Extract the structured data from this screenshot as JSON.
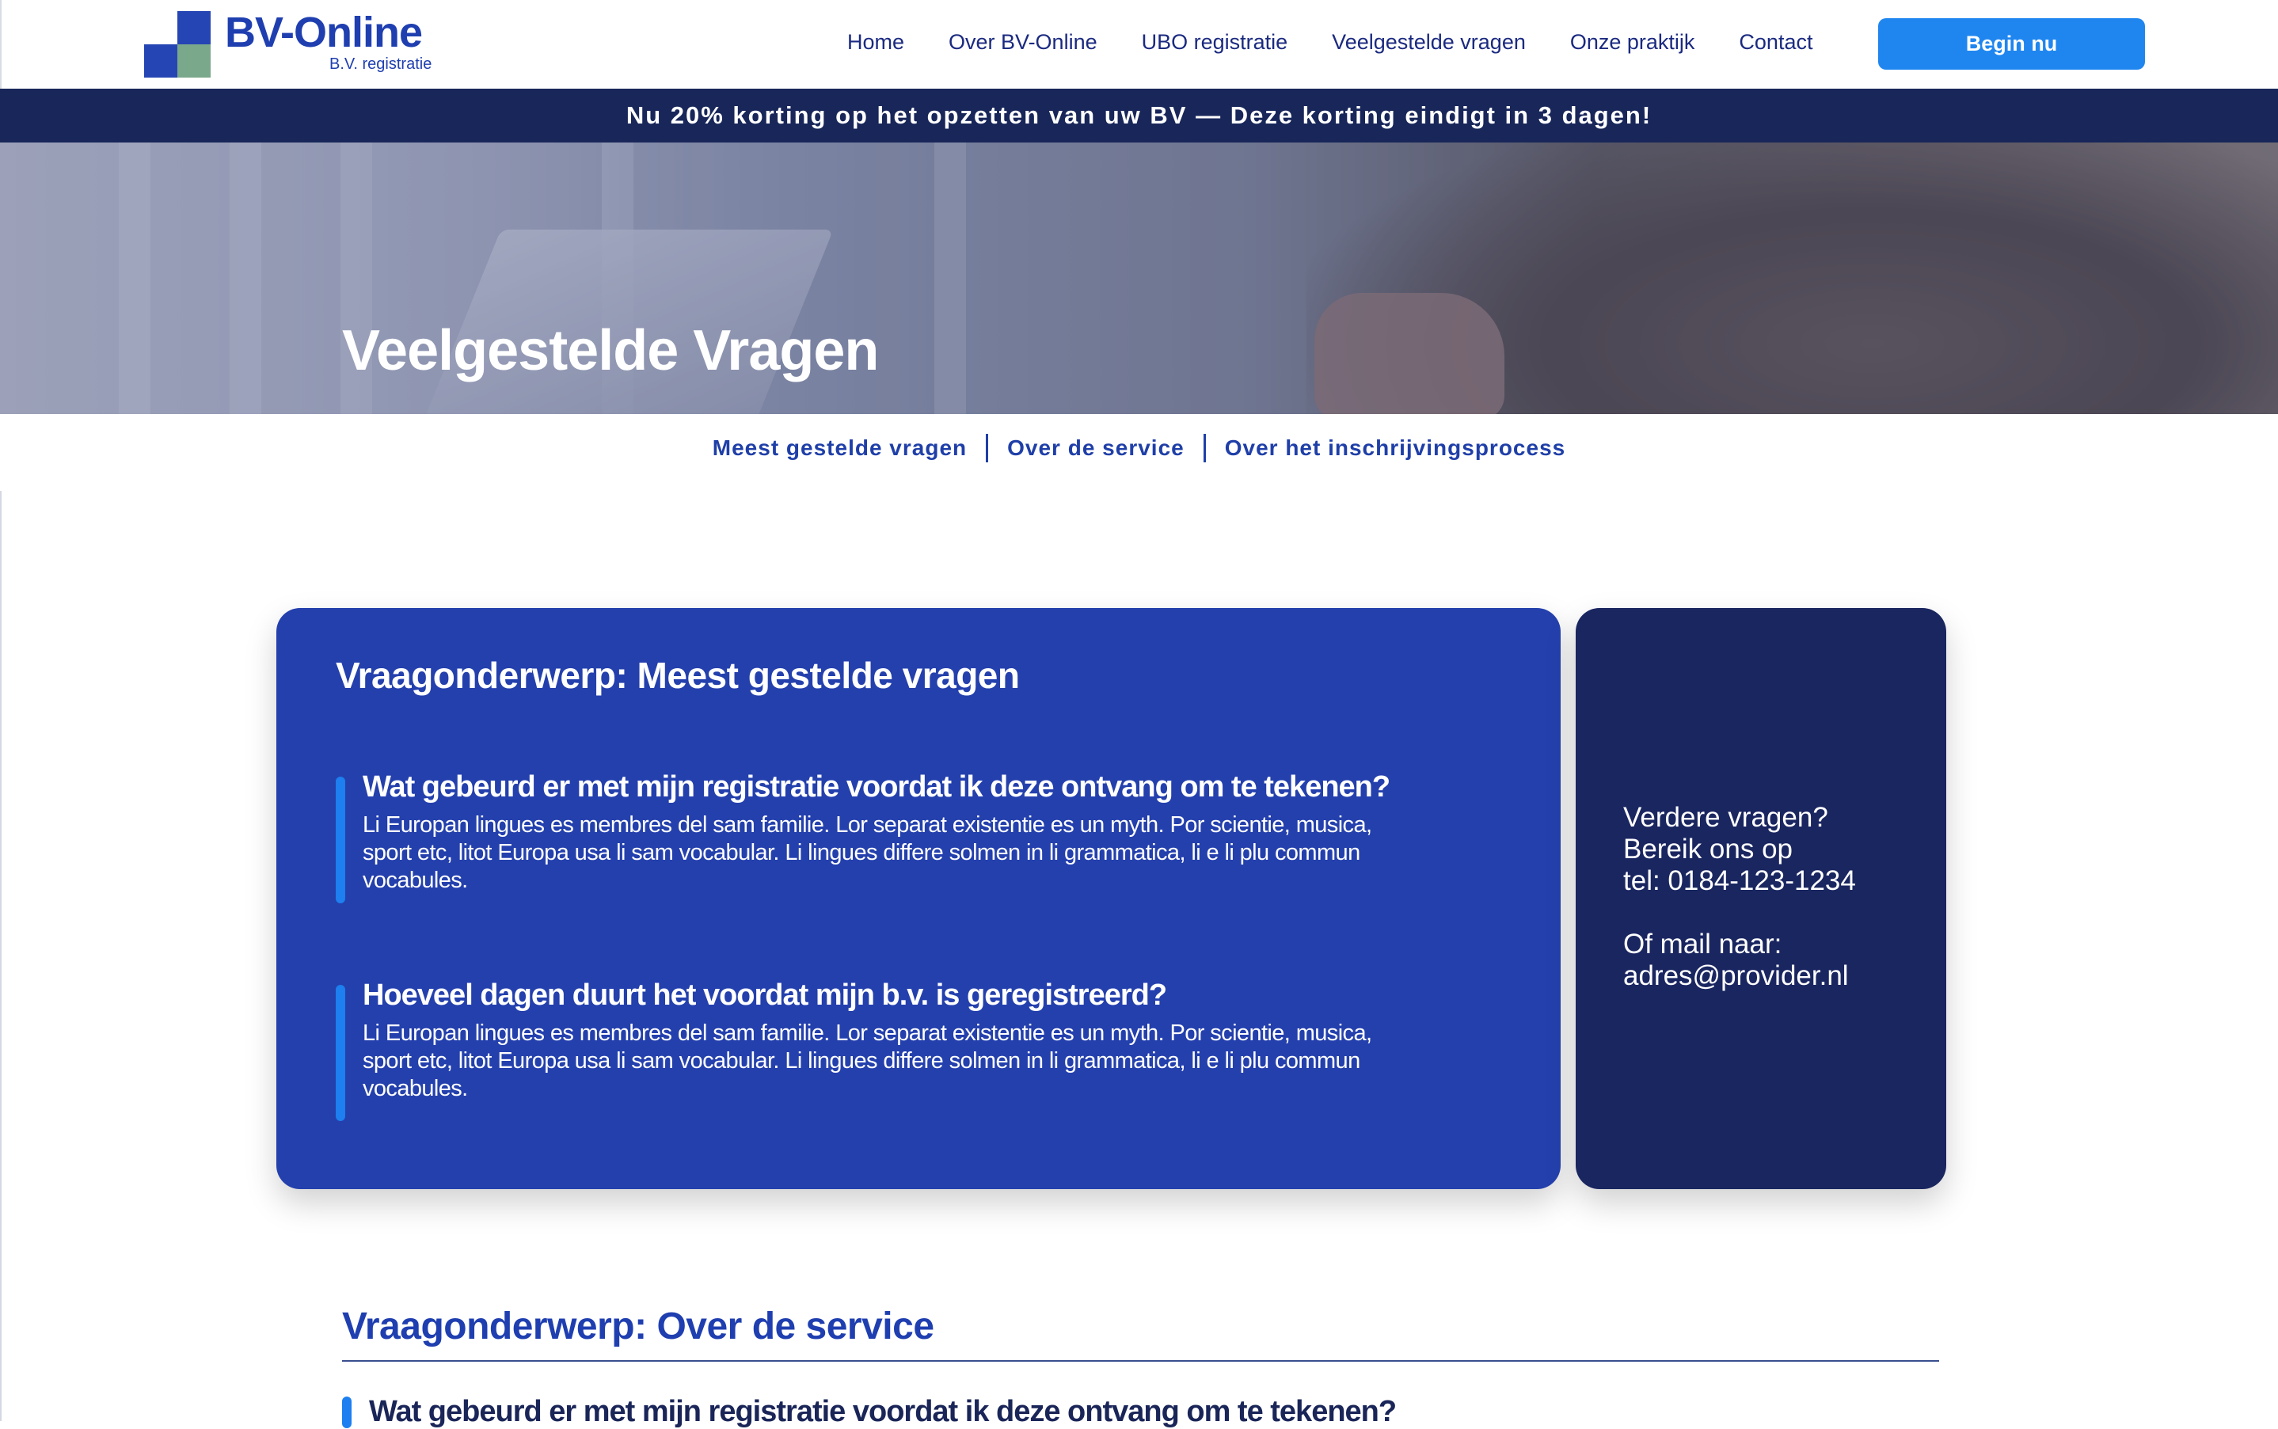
{
  "brand": {
    "title": "BV-Online",
    "subtitle": "B.V. registratie",
    "colors": {
      "primary": "#2440ad",
      "accent": "#1f86f0",
      "dark": "#1a2660",
      "logo_green": "#7aa88a"
    }
  },
  "nav": {
    "items": [
      {
        "label": "Home"
      },
      {
        "label": "Over BV-Online"
      },
      {
        "label": "UBO registratie"
      },
      {
        "label": "Veelgestelde vragen"
      },
      {
        "label": "Onze praktijk"
      },
      {
        "label": "Contact"
      }
    ],
    "cta_label": "Begin nu"
  },
  "promo": {
    "text": "Nu 20% korting op het opzetten van uw BV — Deze korting eindigt in 3 dagen!"
  },
  "hero": {
    "title": "Veelgestelde Vragen"
  },
  "topics": {
    "links": [
      {
        "label": "Meest gestelde vragen"
      },
      {
        "label": "Over de service"
      },
      {
        "label": "Over het inschrijvingsprocess"
      }
    ]
  },
  "faq_section_1": {
    "title": "Vraagonderwerp: Meest gestelde vragen",
    "items": [
      {
        "question": "Wat gebeurd er met mijn registratie voordat ik deze ontvang om te tekenen?",
        "answer": "Li Europan lingues es membres del sam familie. Lor separat existentie es un myth. Por scientie, musica, sport etc, litot Europa usa li sam vocabular. Li lingues differe solmen in li grammatica, li  e li plu commun vocabules."
      },
      {
        "question": "Hoeveel dagen duurt het voordat mijn b.v. is geregistreerd?",
        "answer": "Li Europan lingues es membres del sam familie. Lor separat existentie es un myth. Por scientie, musica, sport etc, litot Europa usa li sam vocabular. Li lingues differe solmen in li grammatica, li  e li plu commun vocabules."
      }
    ]
  },
  "contact": {
    "line1": "Verdere vragen?",
    "line2": "Bereik ons op",
    "line3": "tel: 0184-123-1234",
    "line4": "Of mail naar:",
    "line5": "adres@provider.nl"
  },
  "faq_section_2": {
    "title": "Vraagonderwerp: Over de service",
    "first_question": "Wat gebeurd er met mijn registratie voordat ik deze ontvang om te tekenen?"
  }
}
